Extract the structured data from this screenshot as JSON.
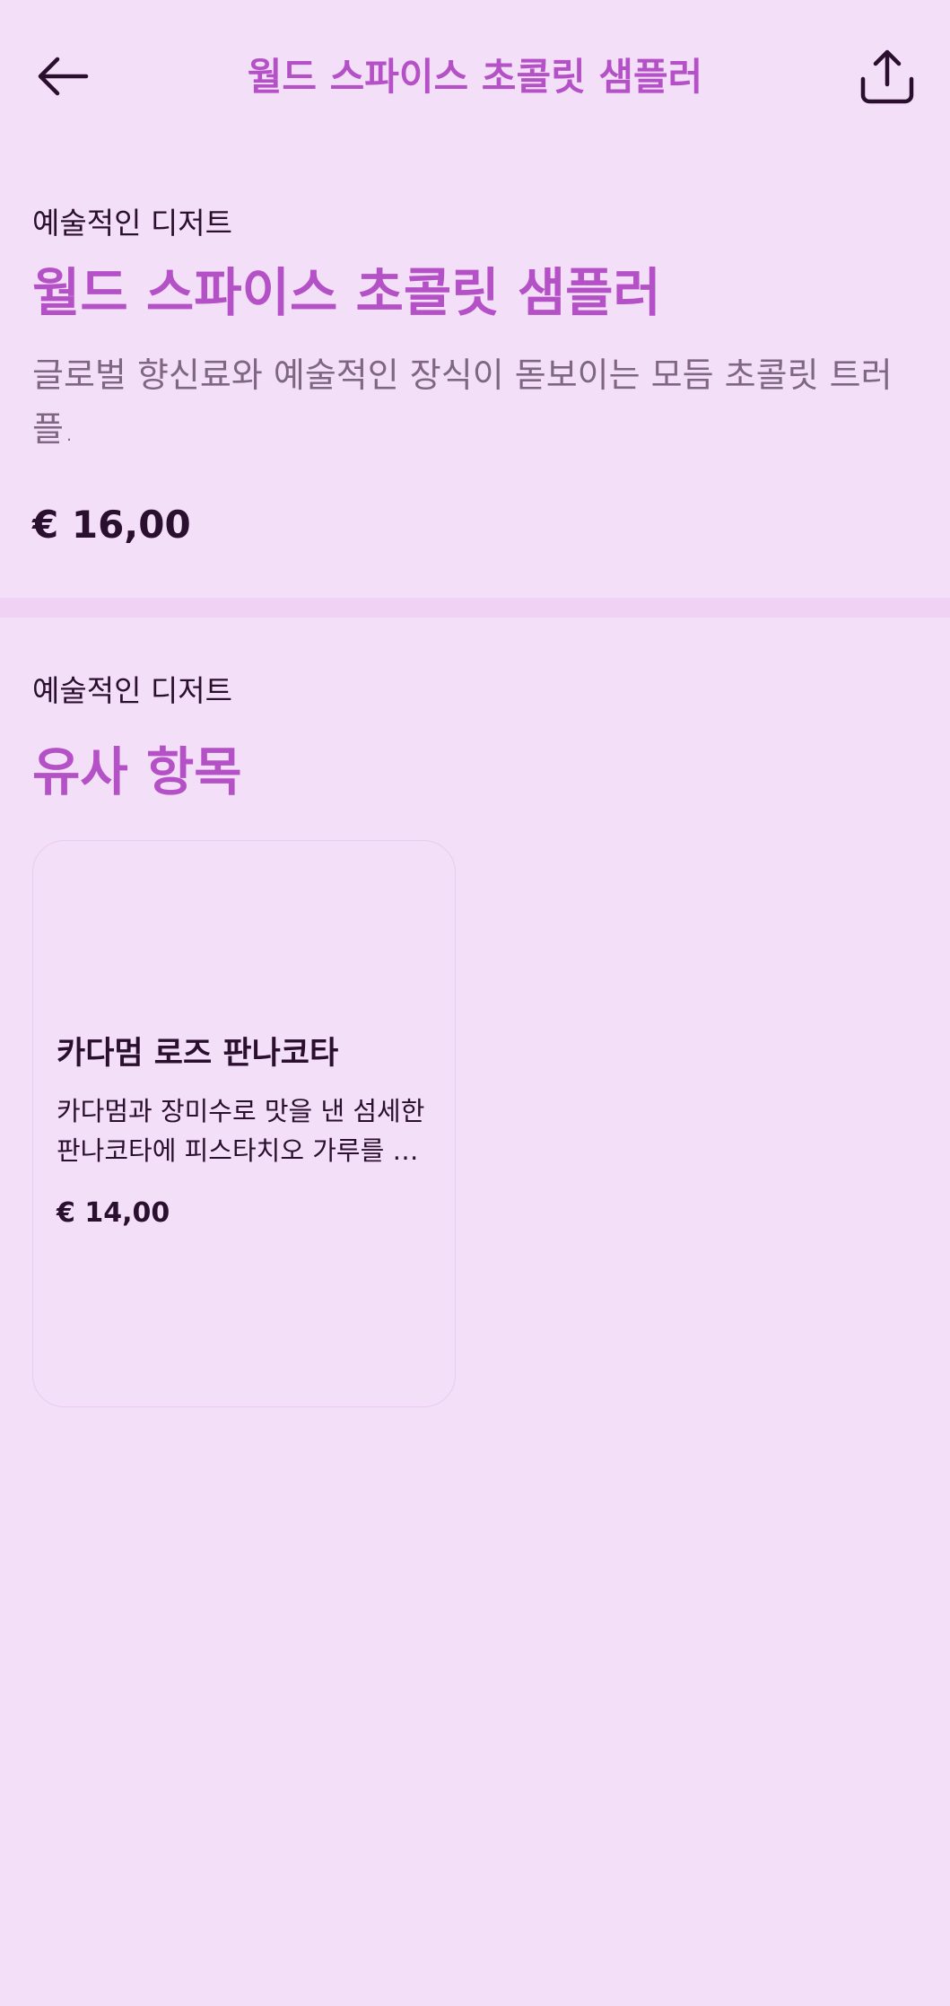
{
  "header": {
    "title": "월드 스파이스 초콜릿 샘플러",
    "back_icon": "arrow-left-icon",
    "share_icon": "share-icon"
  },
  "product": {
    "category": "예술적인 디저트",
    "title": "월드 스파이스 초콜릿 샘플러",
    "description": "글로벌 향신료와 예술적인 장식이 돋보이는 모듬 초콜릿 트러플.",
    "price": "€ 16,00"
  },
  "similar": {
    "category": "예술적인 디저트",
    "title": "유사 항목",
    "items": [
      {
        "title": "카다멈 로즈 판나코타",
        "description": "카다멈과 장미수로 맛을 낸 섬세한 판나코타에 피스타치오 가루를 뿌린 디저트",
        "price": "€ 14,00"
      }
    ]
  },
  "colors": {
    "background": "#f4dff8",
    "accent": "#b451c6",
    "text": "#2a0f2e",
    "muted": "#7f6784"
  }
}
